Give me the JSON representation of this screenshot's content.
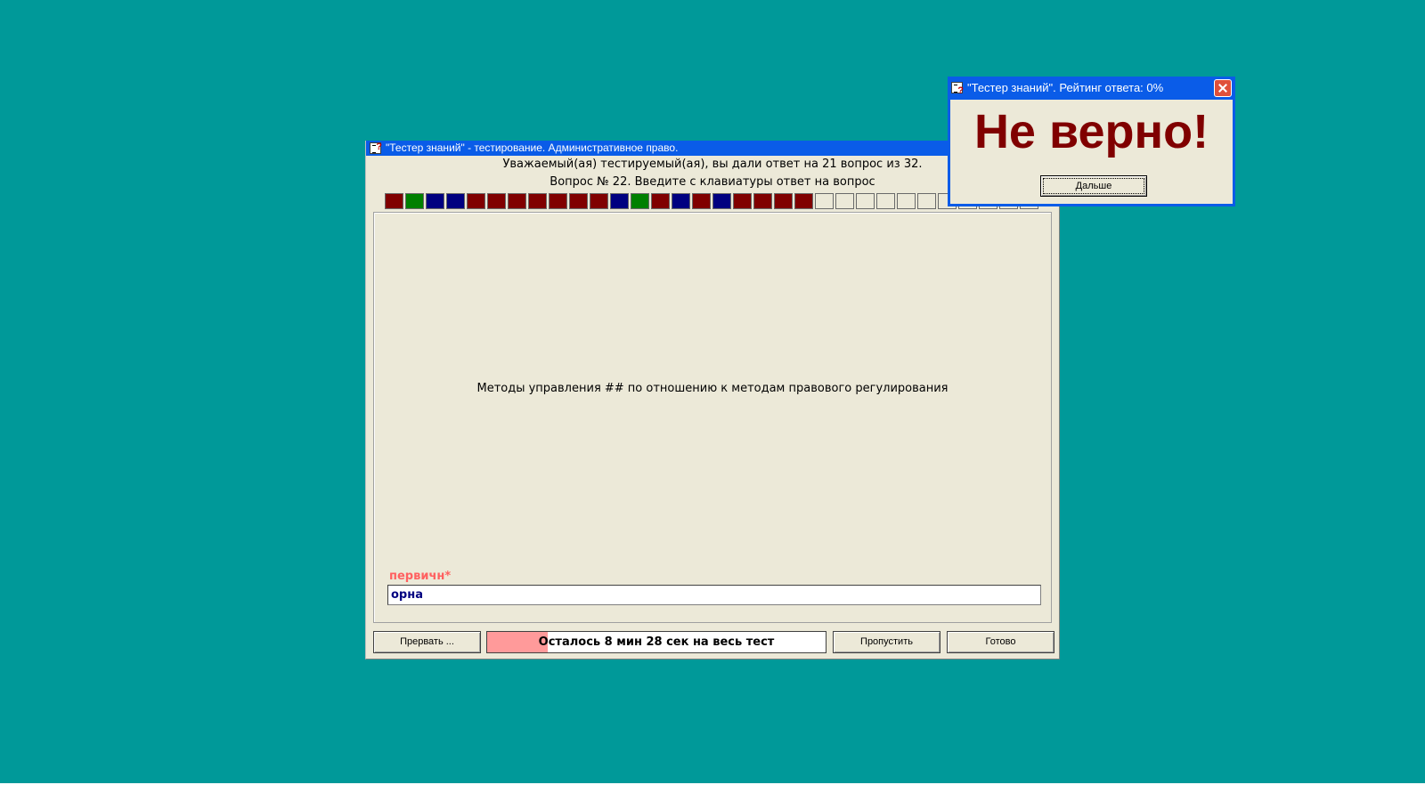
{
  "main_window": {
    "title": "\"Тестер знаний\" - тестирование. Административное право.",
    "info_line1": "Уважаемый(ая) тестируемый(ая), вы дали ответ на 21 вопрос из 32.",
    "info_line2": "Вопрос № 22. Введите с клавиатуры ответ на вопрос",
    "question_text": "Методы управления ## по отношению к методам правового регулирования",
    "hint_label": "первичн*",
    "answer_value": "орна",
    "progress_squares": [
      "wrong",
      "correct",
      "partial",
      "partial",
      "wrong",
      "wrong",
      "wrong",
      "wrong",
      "wrong",
      "wrong",
      "wrong",
      "partial",
      "correct",
      "wrong",
      "partial",
      "wrong",
      "partial",
      "wrong",
      "wrong",
      "wrong",
      "wrong",
      "empty",
      "empty",
      "empty",
      "empty",
      "empty",
      "empty",
      "empty",
      "empty",
      "empty",
      "empty",
      "empty"
    ],
    "colors": {
      "wrong": "#800000",
      "correct": "#008000",
      "partial": "#000080",
      "empty": "#ece9d8",
      "timer_fill": "#ff9a9a"
    },
    "buttons": {
      "abort": "Прервать ...",
      "skip": "Пропустить",
      "done": "Готово"
    },
    "timer": {
      "text": "Осталось 8 мин 28 сек на весь тест",
      "progress_fraction": 0.18
    }
  },
  "dialog": {
    "title": "\"Тестер знаний\". Рейтинг ответа: 0%",
    "message": "Не верно!",
    "button": "Дальше"
  },
  "icons": [
    "app-icon",
    "close-icon"
  ]
}
